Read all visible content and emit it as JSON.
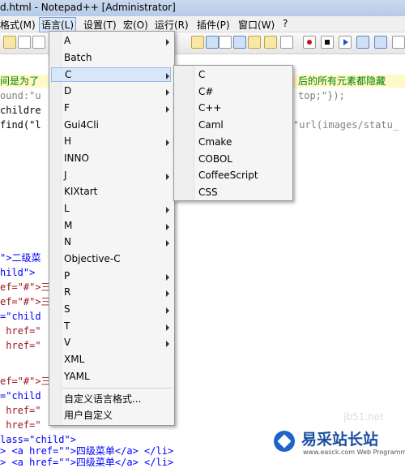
{
  "window": {
    "title": "d.html - Notepad++ [Administrator]"
  },
  "menubar": {
    "items": [
      "格式(M)",
      "语言(L)",
      "设置(T)",
      "宏(O)",
      "运行(R)",
      "插件(P)",
      "窗口(W)",
      "?"
    ],
    "active": "语言(L)"
  },
  "editor": {
    "lines": {
      "l1a": "间是为了",
      "l1b": "后的所有元素都隐藏",
      "l2a": "ound:\"u",
      "l2b": "top;\"});",
      "l3": "childre",
      "l4a": "find(\"l",
      "l4b": "\"url(images/statu_",
      "l5a": "\">二级菜",
      "l5b": "hild\">",
      "l6": "ef=\"#\">三",
      "l7": "ef=\"#\">三",
      "l8": "=\"child",
      "l9": " href=\"",
      "l10": " href=\"",
      "l11": "ef=\"#\">三",
      "l12": "=\"child",
      "l13": " href=\"",
      "l14": " href=\"",
      "l15": "lass=\"child\">",
      "l16": "> <a href=\"\">四级菜单</a> </li>",
      "l17": "> <a href=\"\">四级菜单</a> </li>"
    }
  },
  "language_menu": {
    "items": [
      {
        "label": "A",
        "submenu": true
      },
      {
        "label": "Batch",
        "submenu": false
      },
      {
        "label": "C",
        "submenu": true,
        "highlighted": true
      },
      {
        "label": "D",
        "submenu": true
      },
      {
        "label": "F",
        "submenu": true
      },
      {
        "label": "Gui4Cli",
        "submenu": false
      },
      {
        "label": "H",
        "submenu": true
      },
      {
        "label": "INNO",
        "submenu": false
      },
      {
        "label": "J",
        "submenu": true
      },
      {
        "label": "KIXtart",
        "submenu": false
      },
      {
        "label": "L",
        "submenu": true
      },
      {
        "label": "M",
        "submenu": true
      },
      {
        "label": "N",
        "submenu": true
      },
      {
        "label": "Objective-C",
        "submenu": false
      },
      {
        "label": "P",
        "submenu": true
      },
      {
        "label": "R",
        "submenu": true
      },
      {
        "label": "S",
        "submenu": true
      },
      {
        "label": "T",
        "submenu": true
      },
      {
        "label": "V",
        "submenu": true
      },
      {
        "label": "XML",
        "submenu": false
      },
      {
        "label": "YAML",
        "submenu": false
      },
      {
        "label": "自定义语言格式...",
        "submenu": false
      },
      {
        "label": "用户自定义",
        "submenu": false
      }
    ]
  },
  "c_submenu": {
    "items": [
      "C",
      "C#",
      "C++",
      "Caml",
      "Cmake",
      "COBOL",
      "CoffeeScript",
      "CSS"
    ]
  },
  "watermark": {
    "brand": "易采站长站",
    "domain_faint": "jb51.net",
    "tagline": "www.easck.com Web Programmer"
  },
  "colors": {
    "highlight": "#d7e6f8",
    "string_gray": "#808080",
    "comment_green": "#008000",
    "brand_blue": "#1a4fa0"
  }
}
